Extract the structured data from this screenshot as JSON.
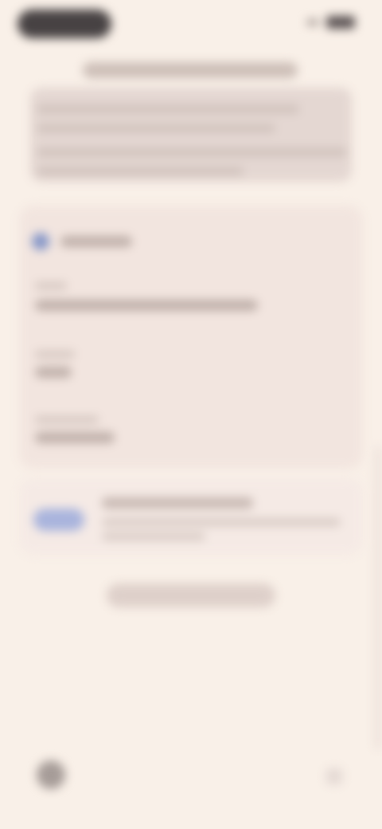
{
  "colors": {
    "background": "#f9f0e8",
    "card": "#f2e5df",
    "summary_card": "#e4d7d2",
    "accent_blue": "#8596c8",
    "avatar_chip": "#a9b4dd",
    "status_pill": "#474243"
  },
  "icons": {
    "detail_icon": "blue-circle-icon",
    "avatar": "avatar-chip-icon",
    "bottom_left": "profile-icon",
    "bottom_right": "arrow-icon",
    "status_bar": [
      "signal-icon",
      "battery-icon"
    ]
  }
}
